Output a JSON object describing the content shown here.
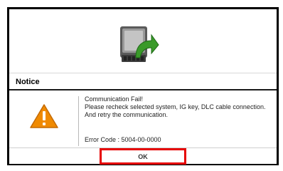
{
  "dialog": {
    "title": "Notice",
    "message_lines": [
      "Communication Fail!",
      "Please recheck selected system, IG key, DLC cable connection.",
      "And retry the communication."
    ],
    "error_code": "Error Code : 5004-00-0000",
    "ok_label": "OK"
  },
  "icons": {
    "ecu": "ecu-module-with-green-arrow-icon",
    "warning": "warning-triangle-icon"
  },
  "colors": {
    "highlight_border": "#e60000",
    "warning_orange": "#f08a00",
    "arrow_green": "#3a9a2a"
  }
}
